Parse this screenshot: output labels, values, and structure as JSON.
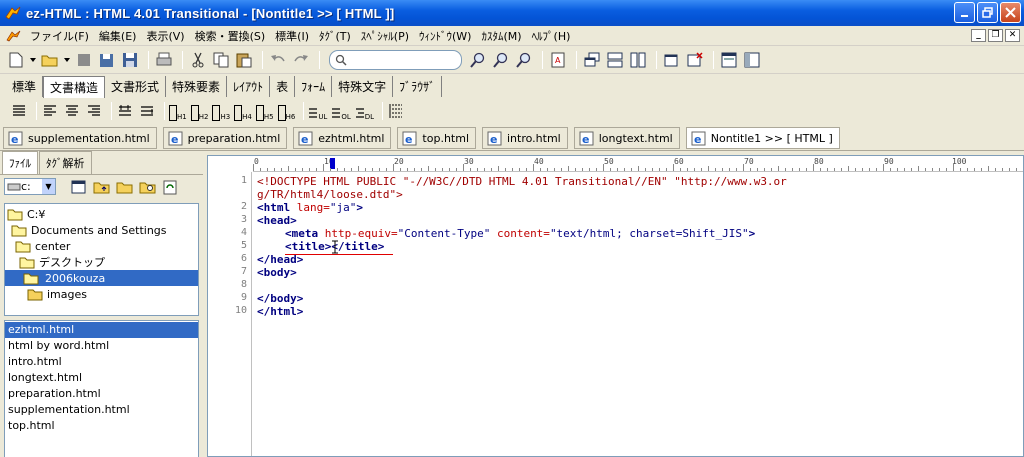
{
  "window": {
    "title": "ez-HTML : HTML 4.01 Transitional - [Nontitle1 >> [ HTML ]]",
    "buttons": [
      "minimize",
      "restore",
      "close"
    ]
  },
  "menu": {
    "items": [
      "ファイル(F)",
      "編集(E)",
      "表示(V)",
      "検索・置換(S)",
      "標準(I)",
      "ﾀｸﾞ(T)",
      "ｽﾍﾟｼｬﾙ(P)",
      "ｳｨﾝﾄﾞｳ(W)",
      "ｶｽﾀﾑ(M)",
      "ﾍﾙﾌﾟ(H)"
    ]
  },
  "category_tabs": [
    "標準",
    "文書構造",
    "文書形式",
    "特殊要素",
    "ﾚｲｱｳﾄ",
    "表",
    "ﾌｫｰﾑ",
    "特殊文字",
    "ﾌﾞﾗｳｻﾞ"
  ],
  "active_category": "文書構造",
  "heading_buttons": [
    "H1",
    "H2",
    "H3",
    "H4",
    "H5",
    "H6"
  ],
  "list_buttons": [
    "UL",
    "OL",
    "DL"
  ],
  "doc_tabs": [
    "supplementation.html",
    "preparation.html",
    "ezhtml.html",
    "top.html",
    "intro.html",
    "longtext.html",
    "Nontitle1 >> [ HTML ]"
  ],
  "left_panel": {
    "tabs": [
      "ﾌｧｲﾙ",
      "ﾀｸﾞ解析"
    ],
    "drive": "c:",
    "tree": [
      "C:¥",
      "Documents and Settings",
      "center",
      "デスクトップ",
      "2006kouza",
      "images"
    ],
    "files": [
      "ezhtml.html",
      "html by word.html",
      "intro.html",
      "longtext.html",
      "preparation.html",
      "supplementation.html",
      "top.html"
    ]
  },
  "editor": {
    "ruler_labels": [
      "0",
      "10",
      "20",
      "30",
      "40",
      "50",
      "60",
      "70",
      "80",
      "90",
      "100"
    ],
    "line_numbers": [
      "1",
      "2",
      "3",
      "4",
      "5",
      "6",
      "7",
      "8",
      "9",
      "10"
    ],
    "code": {
      "l1a": "<!DOCTYPE HTML PUBLIC \"-//W3C//DTD HTML 4.01 Transitional//EN\" \"http://www.w3.or",
      "l1b": "g/TR/html4/loose.dtd\">",
      "l2_tag_open": "<html",
      "l2_attr": " lang=",
      "l2_val": "\"ja\"",
      "l2_end": ">",
      "l3": "<head>",
      "l4_tag": "<meta",
      "l4_attr1": " http-equiv=",
      "l4_val1": "\"Content-Type\"",
      "l4_attr2": " content=",
      "l4_val2": "\"text/html; charset=Shift_JIS\"",
      "l4_end": ">",
      "l5a": "<title>",
      "l5b": "</title>",
      "l6": "</head>",
      "l7": "<body>",
      "l9": "</body>",
      "l10": "</html>"
    }
  }
}
